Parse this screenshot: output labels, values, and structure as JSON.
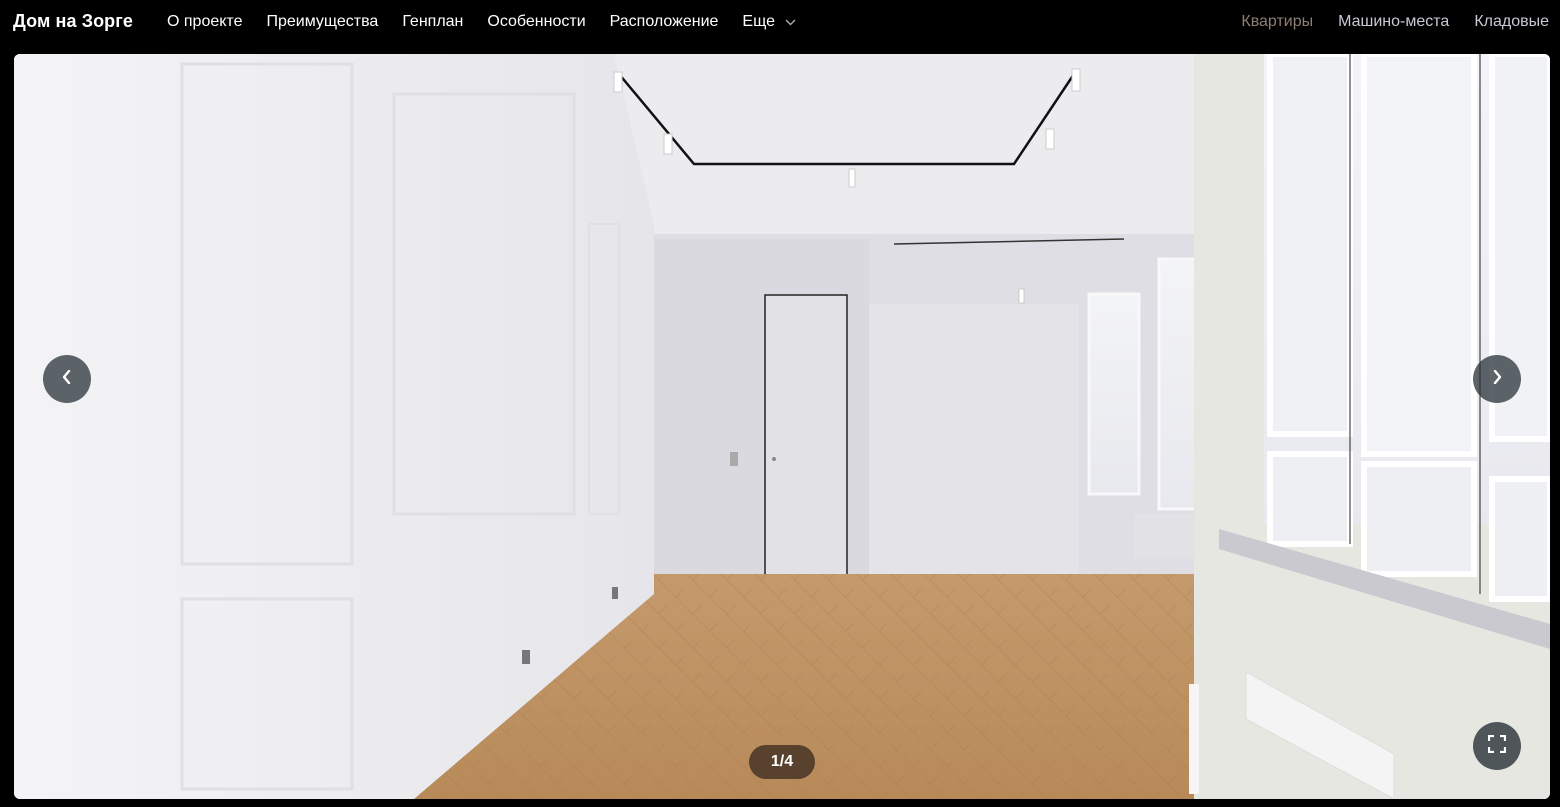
{
  "header": {
    "brand": "Дом на Зорге",
    "nav": [
      {
        "label": "О проекте"
      },
      {
        "label": "Преимущества"
      },
      {
        "label": "Генплан"
      },
      {
        "label": "Особенности"
      },
      {
        "label": "Расположение"
      },
      {
        "label": "Еще"
      }
    ],
    "right_nav": [
      {
        "label": "Квартиры",
        "color": "#8c7f74"
      },
      {
        "label": "Машино-места",
        "color": "#c9c9d4"
      },
      {
        "label": "Кладовые",
        "color": "#c9c9d4"
      }
    ]
  },
  "gallery": {
    "counter": "1/4",
    "current": 1,
    "total": 4
  },
  "icons": {
    "prev": "chevron-left-icon",
    "next": "chevron-right-icon",
    "more": "chevron-down-icon",
    "fullscreen": "fullscreen-icon"
  }
}
